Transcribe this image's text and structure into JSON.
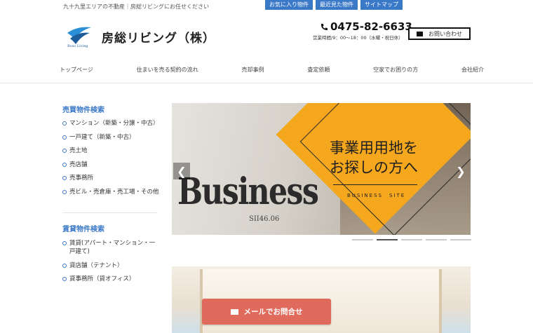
{
  "header": {
    "tagline": "九十九里エリアの不動産｜房総リビングにお任せください",
    "top_links": [
      "お気に入り物件",
      "最近見た物件",
      "サイトマップ"
    ],
    "logo_sub": "Boso Living",
    "company_name": "房総リビング（株）",
    "phone": "0475-82-6633",
    "hours": "営業時間/9：00〜18：00（水曜・祝日休）",
    "contact_label": "お問い合わせ"
  },
  "nav": [
    "トップページ",
    "住まいを売る契約の流れ",
    "売却事例",
    "査定依頼",
    "空家でお困りの方",
    "会社紹介"
  ],
  "sidebar": {
    "sale_heading": "売買物件検索",
    "sale_items": [
      "マンション（新築・分譲・中古）",
      "一戸建て（新築・中古）",
      "売土地",
      "売店舗",
      "売事務所",
      "売ビル・売倉庫・売工場・その他"
    ],
    "rent_heading": "賃貸物件検索",
    "rent_items": [
      "賃貸(アパート・マンション・一戸建て)",
      "貸店舗（テナント）",
      "貸事務所（貸オフィス）"
    ]
  },
  "slider": {
    "bg_word": "Business",
    "bg_small": "SII46.06",
    "headline_line1": "事業用用地を",
    "headline_line2": "お探しの方へ",
    "subline": "BUSINESS　SITE",
    "prev_icon": "chevron-left-icon",
    "next_icon": "chevron-right-icon",
    "dot_count": 5,
    "active_dot": 1
  },
  "float_button": {
    "label": "メールでお問合せ"
  },
  "colors": {
    "accent": "#3a78c8",
    "slider_orange": "#f5a71d",
    "mail_button": "#e06a5c"
  }
}
